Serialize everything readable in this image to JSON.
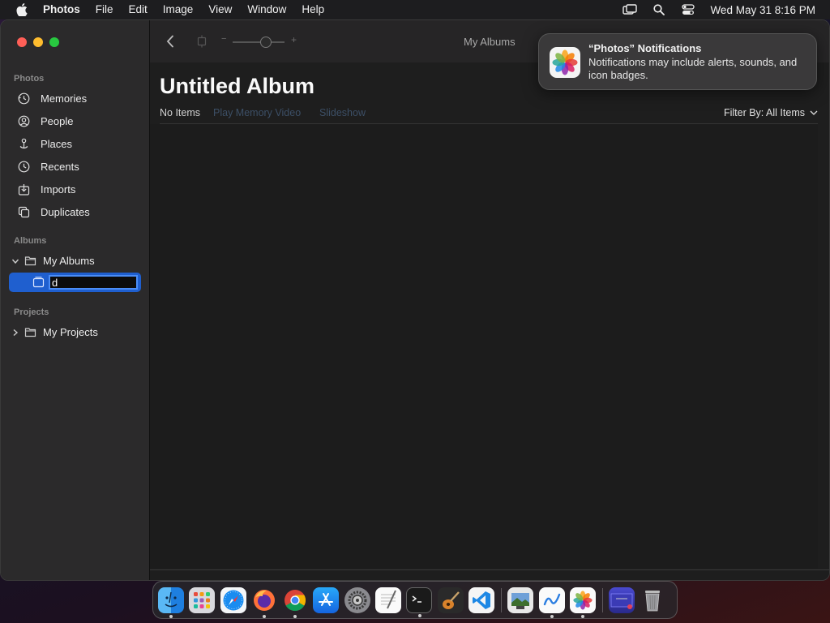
{
  "menubar": {
    "app_name": "Photos",
    "menus": [
      "File",
      "Edit",
      "Image",
      "View",
      "Window",
      "Help"
    ],
    "clock": "Wed May 31  8:16 PM",
    "status_icons": [
      "screen-mirroring-icon",
      "spotlight-icon",
      "control-center-icon"
    ]
  },
  "sidebar": {
    "photos_heading": "Photos",
    "library_items": [
      {
        "label": "Memories",
        "icon": "memories-icon"
      },
      {
        "label": "People",
        "icon": "people-icon"
      },
      {
        "label": "Places",
        "icon": "places-pin-icon"
      },
      {
        "label": "Recents",
        "icon": "recents-clock-icon"
      },
      {
        "label": "Imports",
        "icon": "imports-icon"
      },
      {
        "label": "Duplicates",
        "icon": "duplicates-icon"
      }
    ],
    "albums_heading": "Albums",
    "my_albums_label": "My Albums",
    "rename_value": "d",
    "projects_heading": "Projects",
    "my_projects_label": "My Projects"
  },
  "toolbar": {
    "zoom_minus": "−",
    "zoom_plus": "+",
    "breadcrumb": "My Albums"
  },
  "album": {
    "title": "Untitled Album",
    "item_count": "No Items",
    "play_memory": "Play Memory Video",
    "slideshow": "Slideshow",
    "filter": "Filter By: All Items"
  },
  "notification": {
    "title": "“Photos” Notifications",
    "body": "Notifications may include alerts, sounds, and icon badges."
  },
  "dock": {
    "apps": [
      "Finder",
      "Launchpad",
      "Safari",
      "Firefox",
      "Chrome",
      "App Store",
      "System Settings",
      "TextEdit",
      "Terminal",
      "GarageBand",
      "VS Code",
      "Preview",
      "Freeform",
      "Photos",
      "Screenshot",
      "Trash"
    ]
  }
}
